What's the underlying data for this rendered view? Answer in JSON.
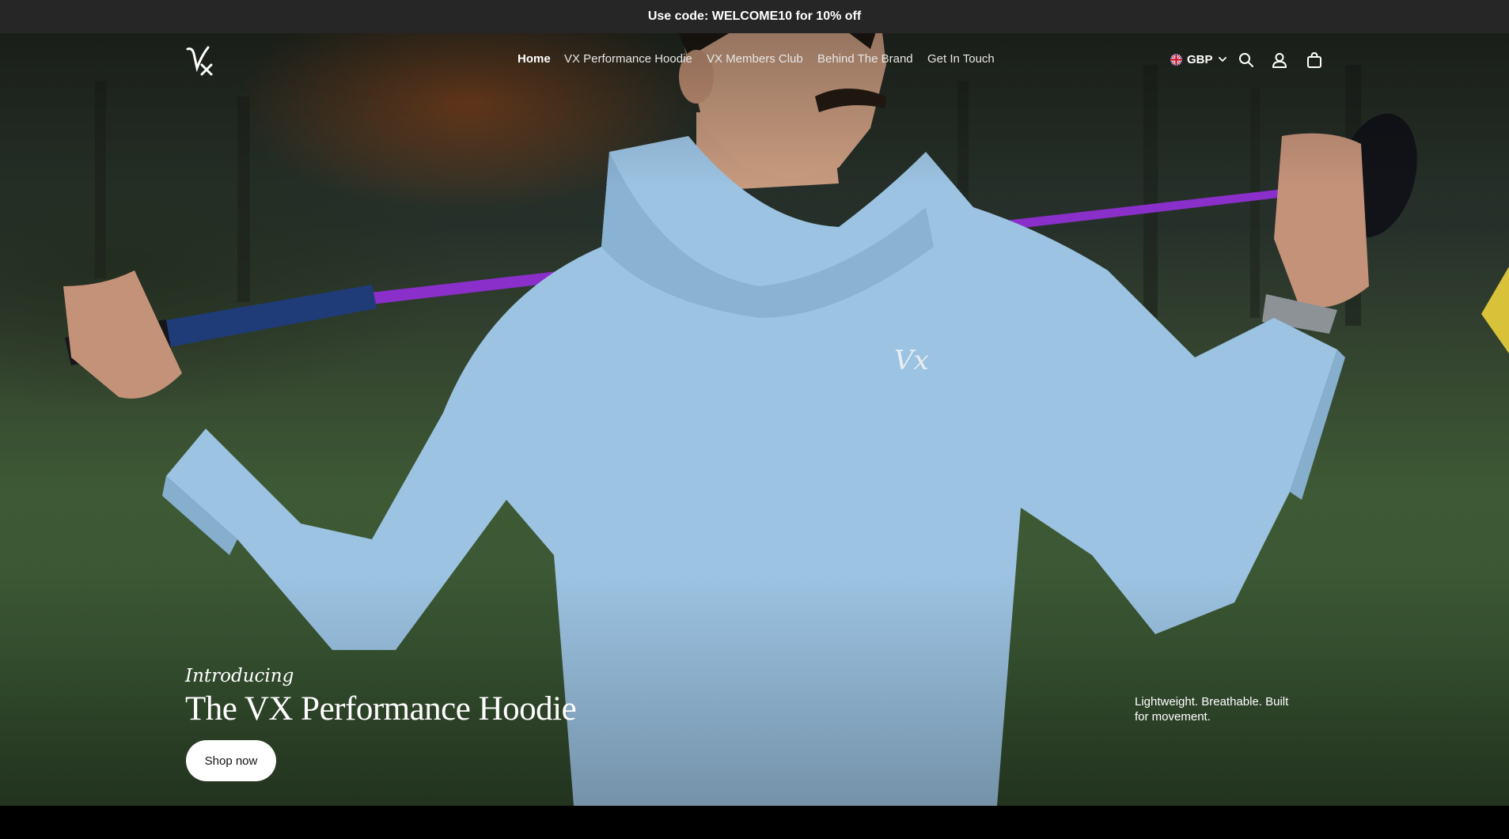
{
  "announcement": {
    "text": "Use code: WELCOME10 for 10% off"
  },
  "header": {
    "logo_icon": "vx-logo",
    "nav": [
      {
        "label": "Home",
        "active": true
      },
      {
        "label": "VX Performance Hoodie",
        "active": false
      },
      {
        "label": "VX Members Club",
        "active": false
      },
      {
        "label": "Behind The Brand",
        "active": false
      },
      {
        "label": "Get In Touch",
        "active": false
      }
    ],
    "currency": {
      "code": "GBP",
      "flag_icon": "uk-flag-icon",
      "caret_icon": "chevron-down-icon"
    },
    "icons": [
      "search-icon",
      "account-icon",
      "cart-icon"
    ]
  },
  "hero": {
    "kicker": "Introducing",
    "title": "The VX Performance Hoodie",
    "cta_label": "Shop now",
    "tagline": "Lightweight. Breathable. Built for movement.",
    "image_subject": "golfer in light blue hoodie holding club behind shoulders",
    "colors": {
      "hoodie": "#9cc3e2",
      "shaft": "#8a2fc9",
      "grass": "#3e5a35"
    }
  }
}
